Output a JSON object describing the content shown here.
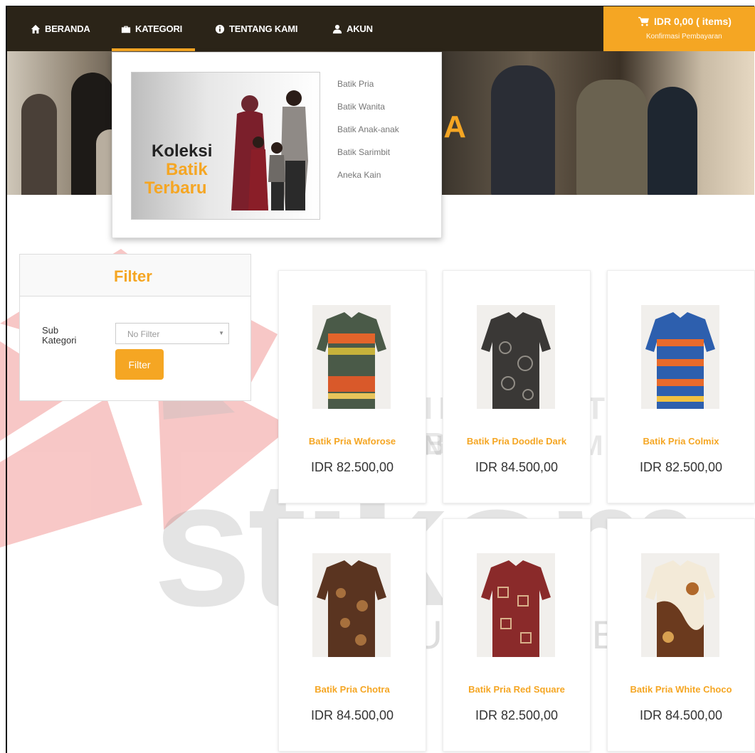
{
  "nav": {
    "items": [
      {
        "label": "BERANDA",
        "icon": "home-icon"
      },
      {
        "label": "KATEGORI",
        "icon": "briefcase-icon"
      },
      {
        "label": "TENTANG KAMI",
        "icon": "info-icon"
      },
      {
        "label": "AKUN",
        "icon": "user-icon"
      }
    ],
    "active": "KATEGORI"
  },
  "cart": {
    "summary": "IDR 0,00 ( items)",
    "link": "Konfirmasi Pembayaran",
    "icon": "cart-icon"
  },
  "hero": {
    "visible_text": "IA"
  },
  "dropdown": {
    "promo_lines": [
      "Koleksi",
      "Batik",
      "Terbaru"
    ],
    "links": [
      "Batik Pria",
      "Batik Wanita",
      "Batik Anak-anak",
      "Batik Sarimbit",
      "Aneka Kain"
    ]
  },
  "filter": {
    "title": "Filter",
    "sub_kategori_label": "Sub Kategori",
    "select_value": "No Filter",
    "button": "Filter"
  },
  "products": [
    {
      "name": "Batik Pria Waforose",
      "price": "IDR 82.500,00"
    },
    {
      "name": "Batik Pria Doodle Dark",
      "price": "IDR 84.500,00"
    },
    {
      "name": "Batik Pria Colmix",
      "price": "IDR 82.500,00"
    },
    {
      "name": "Batik Pria Chotra",
      "price": "IDR 84.500,00"
    },
    {
      "name": "Batik Pria Red Square",
      "price": "IDR 82.500,00"
    },
    {
      "name": "Batik Pria White Choco",
      "price": "IDR 84.500,00"
    }
  ],
  "watermark": {
    "line1": "INSTITUT BISNIS",
    "line2": "DAN INFORMATIKA",
    "word": "stikom",
    "city": "SURABAYA"
  },
  "colors": {
    "accent": "#f5a623",
    "navbar": "#2b2418",
    "watermark": "#e53935"
  }
}
